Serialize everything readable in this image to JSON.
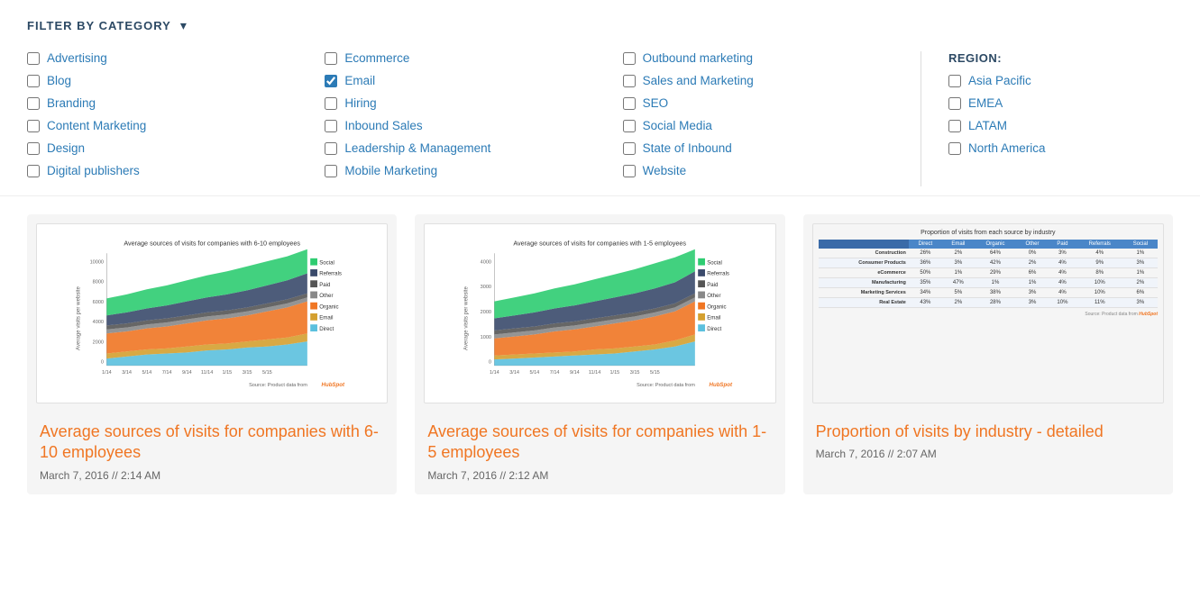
{
  "filter": {
    "header": "FILTER BY CATEGORY",
    "chevron": "▾",
    "columns": {
      "col1": {
        "items": [
          {
            "label": "Advertising",
            "checked": false
          },
          {
            "label": "Blog",
            "checked": false
          },
          {
            "label": "Branding",
            "checked": false
          },
          {
            "label": "Content Marketing",
            "checked": false
          },
          {
            "label": "Design",
            "checked": false
          },
          {
            "label": "Digital publishers",
            "checked": false
          }
        ]
      },
      "col2": {
        "items": [
          {
            "label": "Ecommerce",
            "checked": false
          },
          {
            "label": "Email",
            "checked": true
          },
          {
            "label": "Hiring",
            "checked": false
          },
          {
            "label": "Inbound Sales",
            "checked": false
          },
          {
            "label": "Leadership & Management",
            "checked": false
          },
          {
            "label": "Mobile Marketing",
            "checked": false
          }
        ]
      },
      "col3": {
        "items": [
          {
            "label": "Outbound marketing",
            "checked": false
          },
          {
            "label": "Sales and Marketing",
            "checked": false
          },
          {
            "label": "SEO",
            "checked": false
          },
          {
            "label": "Social Media",
            "checked": false
          },
          {
            "label": "State of Inbound",
            "checked": false
          },
          {
            "label": "Website",
            "checked": false
          }
        ]
      },
      "region": {
        "label": "REGION:",
        "items": [
          {
            "label": "Asia Pacific",
            "checked": false
          },
          {
            "label": "EMEA",
            "checked": false
          },
          {
            "label": "LATAM",
            "checked": false
          },
          {
            "label": "North America",
            "checked": false
          }
        ]
      }
    }
  },
  "cards": [
    {
      "title": "Average sources of visits for companies with 6-10 employees",
      "date": "March 7, 2016 // 2:14 AM",
      "chart_title": "Average sources of visits for companies with 6-10 employees",
      "y_axis": "Average visits per website",
      "legend": [
        "Social",
        "Referrals",
        "Paid",
        "Other",
        "Organic",
        "Email",
        "Direct"
      ],
      "source": "Source: Product data from HubSpot"
    },
    {
      "title": "Average sources of visits for companies with 1-5 employees",
      "date": "March 7, 2016 // 2:12 AM",
      "chart_title": "Average sources of visits for companies with 1-5 employees",
      "y_axis": "Average visits per website",
      "legend": [
        "Social",
        "Referrals",
        "Paid",
        "Other",
        "Organic",
        "Email",
        "Direct"
      ],
      "source": "Source: Product data from HubSpot"
    },
    {
      "title": "Proportion of visits by industry - detailed",
      "date": "March 7, 2016 // 2:07 AM",
      "table_title": "Proportion of visits from each source by industry",
      "headers": [
        "Direct",
        "Email",
        "Organic",
        "Other",
        "Paid",
        "Referrals",
        "Social"
      ],
      "rows": [
        {
          "label": "Construction",
          "values": [
            "26%",
            "2%",
            "64%",
            "0%",
            "3%",
            "4%",
            "1%"
          ]
        },
        {
          "label": "Consumer Products",
          "values": [
            "36%",
            "3%",
            "42%",
            "2%",
            "4%",
            "9%",
            "3%"
          ]
        },
        {
          "label": "eCommerce",
          "values": [
            "50%",
            "1%",
            "29%",
            "6%",
            "4%",
            "8%",
            "1%"
          ]
        },
        {
          "label": "Manufacturing",
          "values": [
            "35%",
            "47%",
            "1%",
            "1%",
            "4%",
            "10%",
            "2%"
          ]
        },
        {
          "label": "Marketing Services",
          "values": [
            "34%",
            "5%",
            "38%",
            "3%",
            "4%",
            "10%",
            "6%"
          ]
        },
        {
          "label": "Real Estate",
          "values": [
            "43%",
            "2%",
            "28%",
            "3%",
            "10%",
            "11%",
            "3%"
          ]
        }
      ]
    }
  ],
  "colors": {
    "social": "#2ecc71",
    "referrals": "#3a4a6b",
    "paid": "#555555",
    "other": "#888888",
    "organic": "#f07623",
    "email": "#d4a030",
    "direct": "#5bc0de",
    "accent": "#f07623",
    "link": "#2c7bb6"
  }
}
